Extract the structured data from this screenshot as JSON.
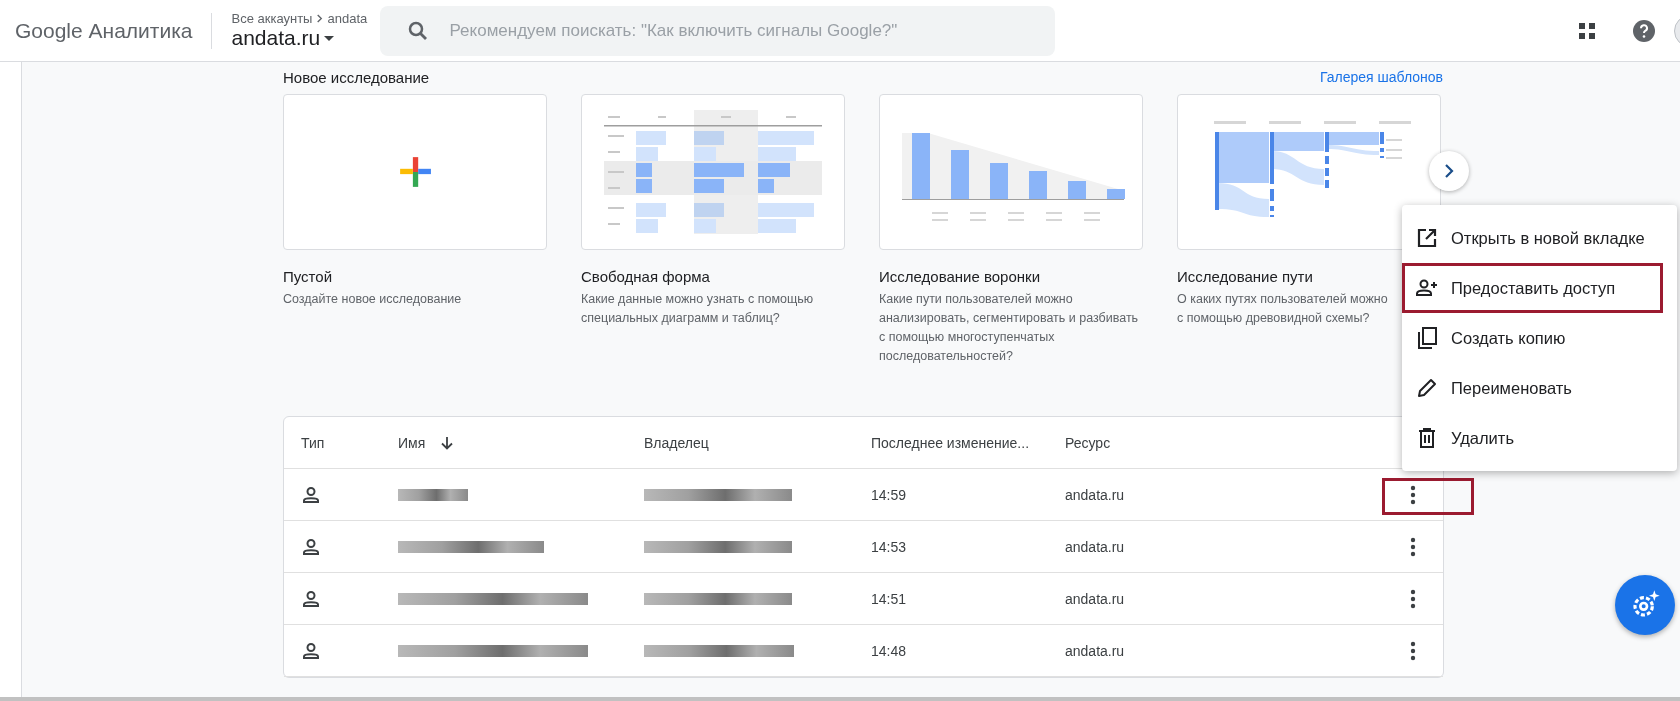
{
  "header": {
    "logo": "Google Аналитика",
    "breadcrumb": [
      "Все аккаунты",
      "andata"
    ],
    "account": "andata.ru",
    "search": {
      "placeholder": "Рекомендуем поискать: \"Как включить сигналы Google?\""
    }
  },
  "section": {
    "title": "Новое исследование",
    "link": "Галерея шаблонов"
  },
  "templates": [
    {
      "kind": "blank",
      "title": "Пустой",
      "description": [
        "Создайте новое исследование"
      ]
    },
    {
      "kind": "freeform",
      "title": "Свободная форма",
      "description": [
        "Какие данные можно узнать с помощью",
        "специальных диаграмм и таблиц?"
      ]
    },
    {
      "kind": "funnel",
      "title": "Исследование воронки",
      "description": [
        "Какие пути пользователей можно",
        "анализировать, сегментировать и разбивать",
        "с помощью многоступенчатых",
        "последовательностей?"
      ]
    },
    {
      "kind": "path",
      "title": "Исследование пути",
      "description": [
        "О каких путях пользователей можно",
        "с помощью древовидной схемы?"
      ]
    }
  ],
  "table": {
    "columns": [
      "Тип",
      "Имя",
      "Владелец",
      "Последнее изменение...",
      "Ресурс"
    ],
    "rows": [
      {
        "modified": "14:59",
        "resource": "andata.ru",
        "highlighted": true
      },
      {
        "modified": "14:53",
        "resource": "andata.ru",
        "highlighted": false
      },
      {
        "modified": "14:51",
        "resource": "andata.ru",
        "highlighted": false
      },
      {
        "modified": "14:48",
        "resource": "andata.ru",
        "highlighted": false
      }
    ]
  },
  "menu": {
    "items": [
      {
        "kind": "open",
        "label": "Открыть в новой вкладке",
        "highlighted": false
      },
      {
        "kind": "share",
        "label": "Предоставить доступ",
        "highlighted": true
      },
      {
        "kind": "copy",
        "label": "Создать копию",
        "highlighted": false
      },
      {
        "kind": "rename",
        "label": "Переименовать",
        "highlighted": false
      },
      {
        "kind": "delete",
        "label": "Удалить",
        "highlighted": false
      }
    ]
  }
}
